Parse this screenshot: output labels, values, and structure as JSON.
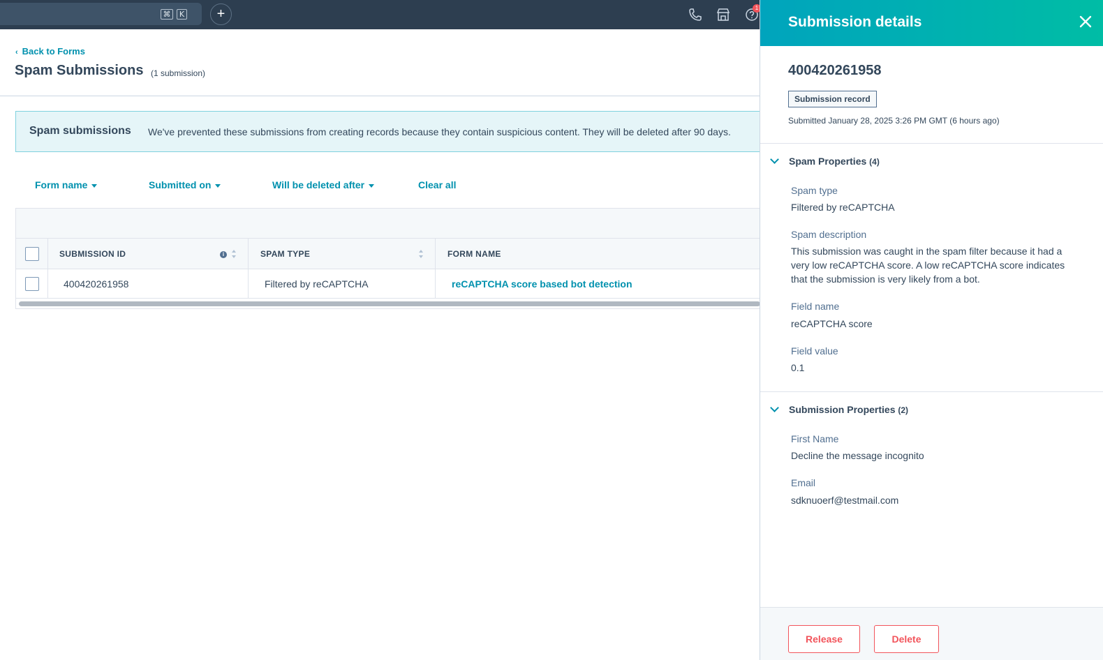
{
  "topbar": {
    "search_shortcut_cmd": "⌘",
    "search_shortcut_key": "K",
    "add_label": "+",
    "notification_count": "1",
    "icons": [
      "phone-icon",
      "marketplace-icon",
      "help-icon"
    ]
  },
  "header": {
    "back_label": "Back to Forms",
    "title": "Spam Submissions",
    "count": "(1 submission)"
  },
  "banner": {
    "title": "Spam submissions",
    "text": "We've prevented these submissions from creating records because they contain suspicious content. They will be deleted after 90 days."
  },
  "filters": {
    "form_name": "Form name",
    "submitted_on": "Submitted on",
    "will_be_deleted_after": "Will be deleted after",
    "clear_all": "Clear all"
  },
  "table": {
    "columns": [
      "SUBMISSION ID",
      "SPAM TYPE",
      "FORM NAME"
    ],
    "rows": [
      {
        "submission_id": "400420261958",
        "spam_type": "Filtered by reCAPTCHA",
        "form_name": "reCAPTCHA score based bot detection"
      }
    ]
  },
  "panel": {
    "title": "Submission details",
    "record_id": "400420261958",
    "badge": "Submission record",
    "submitted": "Submitted January 28, 2025 3:26 PM GMT (6 hours ago)",
    "spam_section": {
      "title": "Spam Properties",
      "count": "(4)",
      "props": [
        {
          "label": "Spam type",
          "value": "Filtered by reCAPTCHA"
        },
        {
          "label": "Spam description",
          "value": "This submission was caught in the spam filter because it had a very low reCAPTCHA score. A low reCAPTCHA score indicates that the submission is very likely from a bot."
        },
        {
          "label": "Field name",
          "value": "reCAPTCHA score"
        },
        {
          "label": "Field value",
          "value": "0.1"
        }
      ]
    },
    "submission_section": {
      "title": "Submission Properties",
      "count": "(2)",
      "props": [
        {
          "label": "First Name",
          "value": "Decline the message incognito"
        },
        {
          "label": "Email",
          "value": "sdknuoerf@testmail.com"
        }
      ]
    },
    "release_label": "Release",
    "delete_label": "Delete"
  },
  "colors": {
    "nav_bg": "#2d3e50",
    "link": "#0091ae",
    "panel_header_start": "#00a4bd",
    "panel_header_end": "#00bda5",
    "danger": "#f2545b",
    "banner_bg": "#e5f5f8"
  }
}
